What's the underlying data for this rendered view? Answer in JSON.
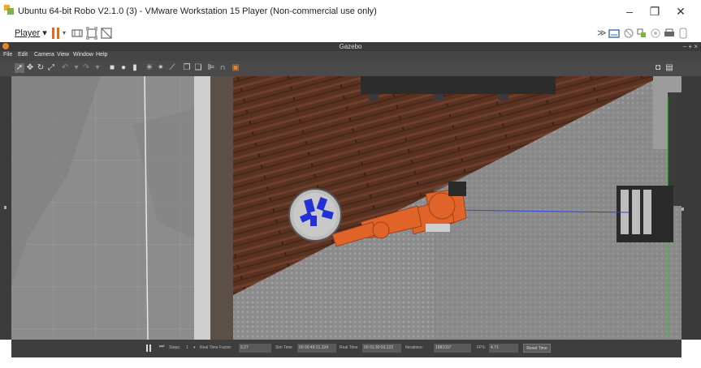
{
  "window": {
    "title": "Ubuntu 64-bit Robo V2.1.0 (3) - VMware Workstation 15 Player (Non-commercial use only)",
    "minimize_icon": "minimize-icon",
    "restore_icon": "restore-icon",
    "close_icon": "close-icon"
  },
  "vm_toolbar": {
    "player_menu": "Player",
    "icons": [
      "pause-icon",
      "send-ctrl-alt-del-icon",
      "fit-guest-icon",
      "unity-icon"
    ],
    "right_icons": [
      "forward-icon",
      "removable-device-icon",
      "network-icon",
      "usb-icon",
      "sound-icon",
      "printer-icon",
      "settings-icon"
    ]
  },
  "gazebo": {
    "title": "Gazebo",
    "window_controls": "− + ×",
    "menus": [
      "File",
      "Edit",
      "Camera",
      "View",
      "Window",
      "Help"
    ],
    "bottom": {
      "steps_label": "Steps:",
      "steps_value": "1",
      "rtf_label": "Real Time Factor:",
      "rtf_value": "0.27",
      "sim_label": "Sim Time",
      "sim_value": "00 00:49:21.324",
      "real_label": "Real Time",
      "real_value": "00 01:30:53.222",
      "iter_label": "Iterations:",
      "iter_value": "1881037",
      "fps_label": "FPS:",
      "fps_value": "4.71",
      "reset_label": "Reset Time"
    }
  },
  "colors": {
    "robot_orange": "#e0632a",
    "floor_wood": "#5a3222",
    "carpet_gray": "#8e8e8e",
    "pause_orange": "#e56a1e",
    "object_blue": "#2230d8"
  }
}
